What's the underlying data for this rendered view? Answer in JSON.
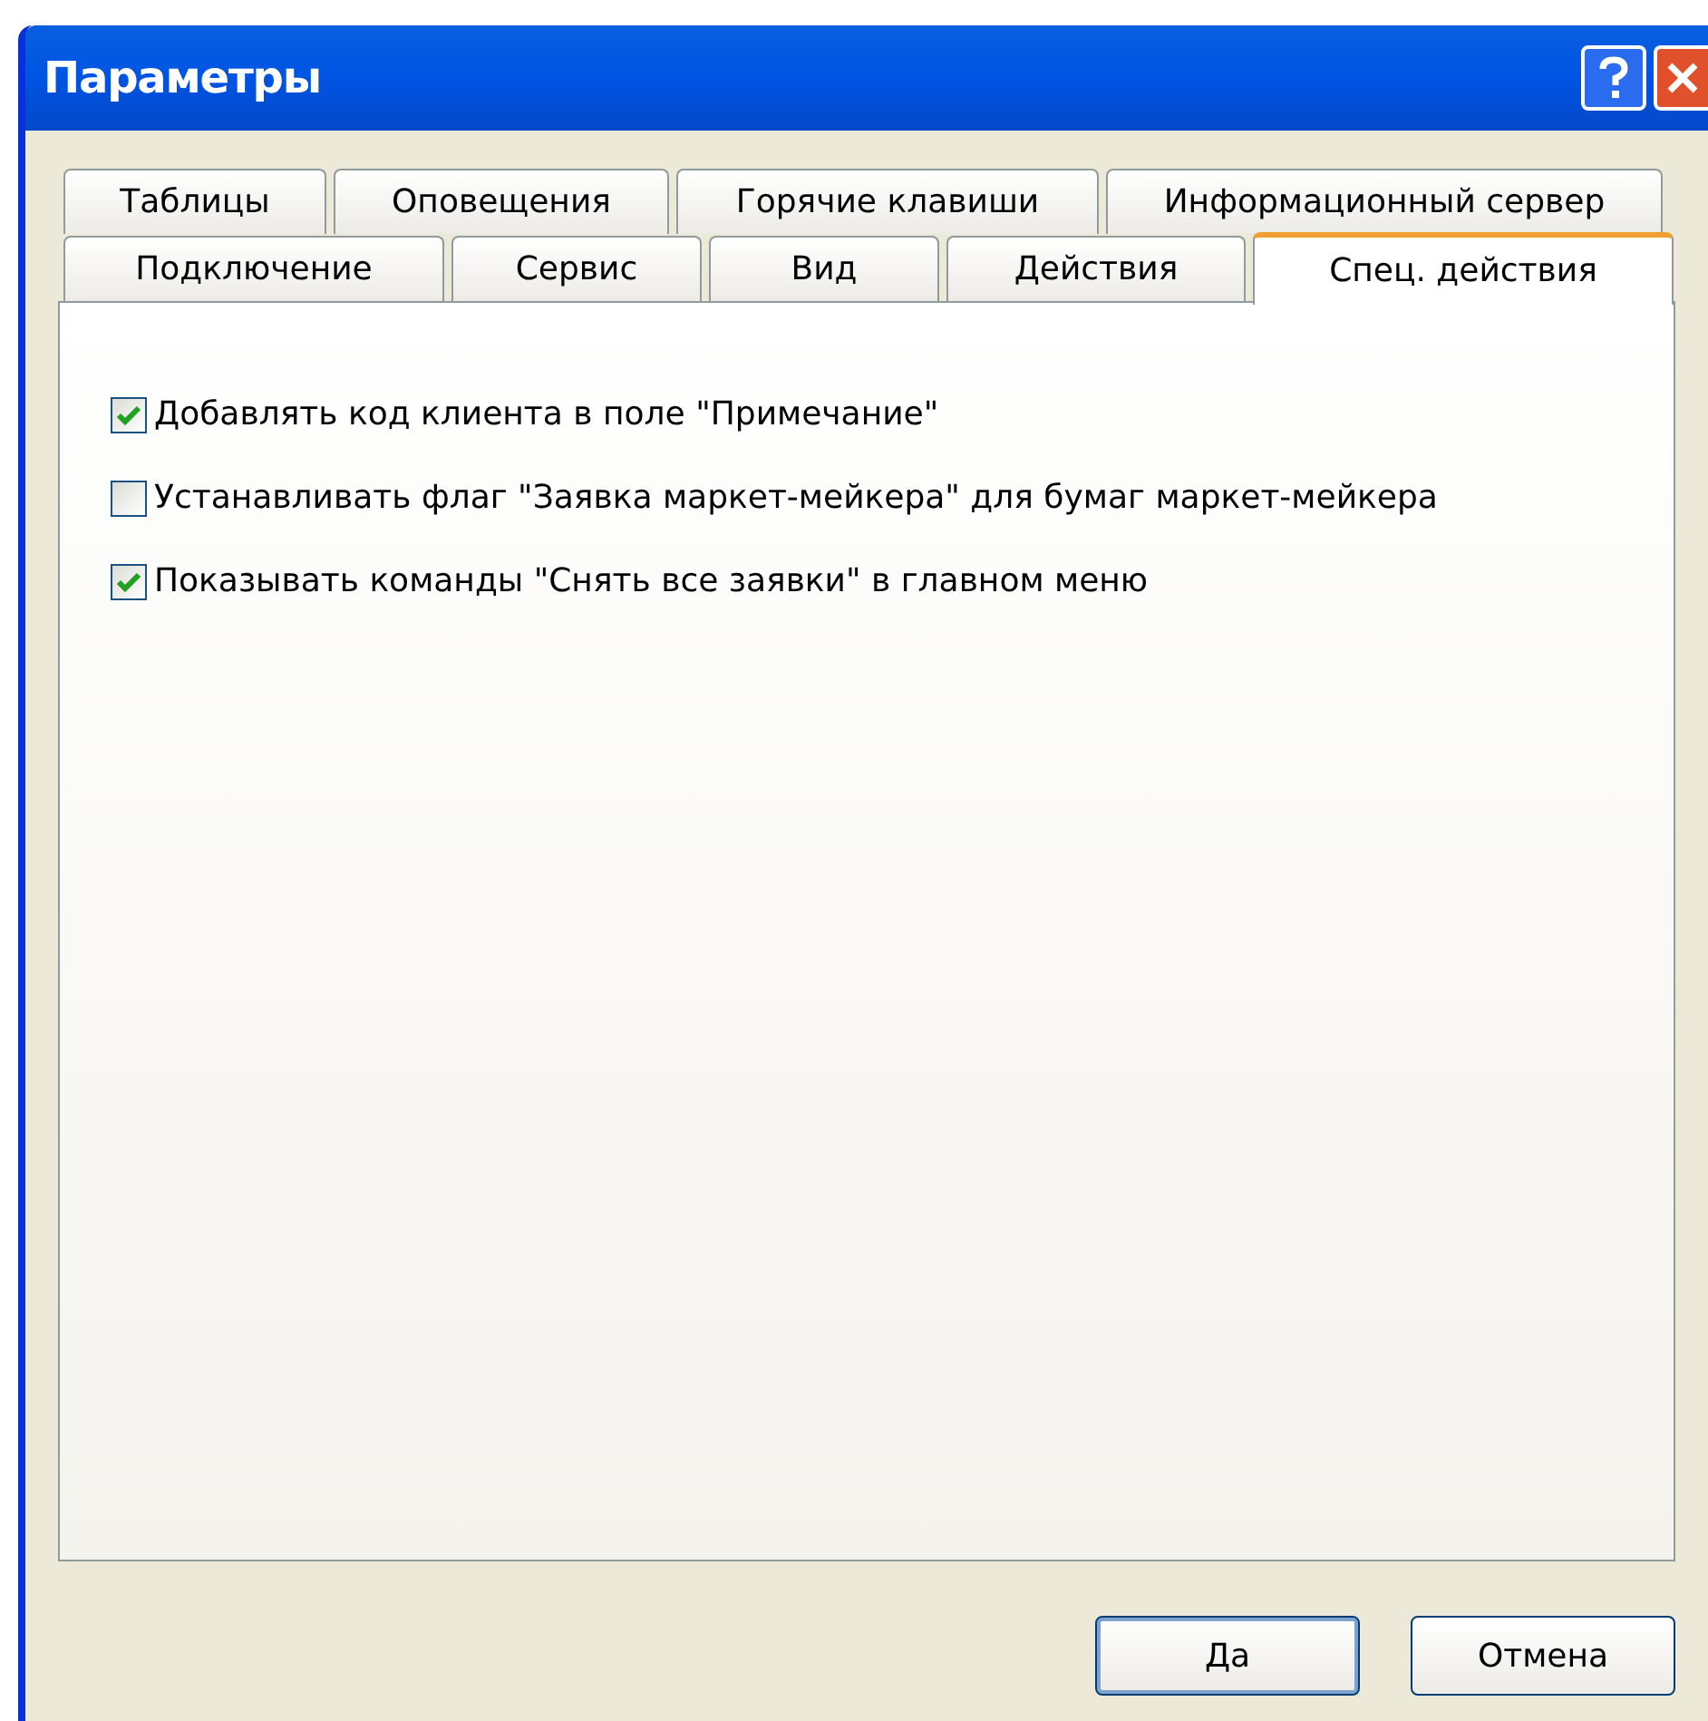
{
  "window": {
    "title": "Параметры"
  },
  "tab_rows": [
    [
      {
        "label": "Таблицы",
        "selected": false
      },
      {
        "label": "Оповещения",
        "selected": false
      },
      {
        "label": "Горячие клавиши",
        "selected": false
      },
      {
        "label": "Информационный сервер",
        "selected": false
      }
    ],
    [
      {
        "label": "Подключение",
        "selected": false
      },
      {
        "label": "Сервис",
        "selected": false
      },
      {
        "label": "Вид",
        "selected": false
      },
      {
        "label": "Действия",
        "selected": false
      },
      {
        "label": "Спец. действия",
        "selected": true
      }
    ]
  ],
  "options": [
    {
      "label": "Добавлять код клиента в поле \"Примечание\"",
      "checked": true
    },
    {
      "label": "Устанавливать флаг \"Заявка маркет-мейкера\" для бумаг маркет-мейкера",
      "checked": false
    },
    {
      "label": "Показывать команды \"Снять все заявки\" в главном меню",
      "checked": true
    }
  ],
  "buttons": [
    {
      "label": "Да",
      "kind": "default"
    },
    {
      "label": "Отмена",
      "kind": "normal"
    }
  ]
}
